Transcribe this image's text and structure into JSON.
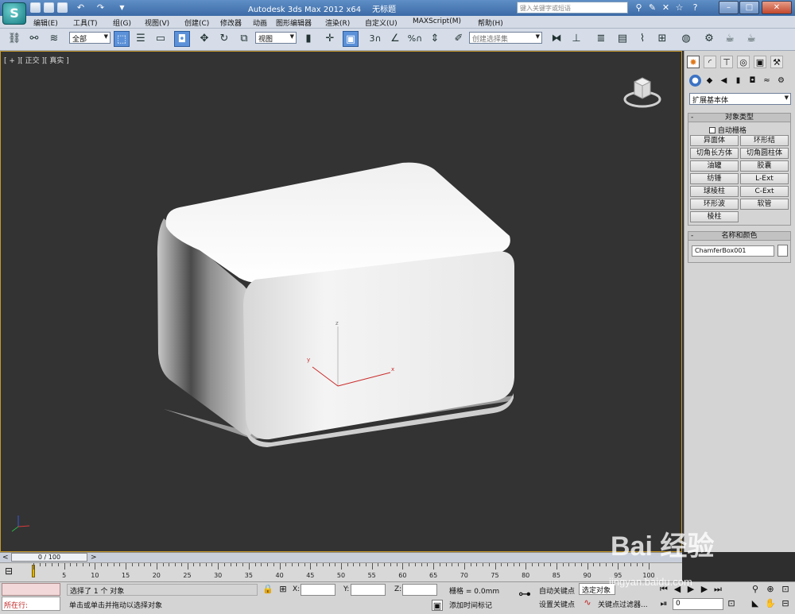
{
  "titlebar": {
    "app_title": "Autodesk 3ds Max  2012 x64",
    "doc_title": "无标题",
    "search_placeholder": "键入关键字或短语"
  },
  "menubar": {
    "items": [
      "编辑(E)",
      "工具(T)",
      "组(G)",
      "视图(V)",
      "创建(C)",
      "修改器",
      "动画",
      "图形编辑器",
      "渲染(R)",
      "自定义(U)",
      "MAXScript(M)",
      "帮助(H)"
    ]
  },
  "toolbar": {
    "selection_filter": "全部",
    "ref_coord": "视图",
    "named_selection": "创建选择集"
  },
  "viewport": {
    "label": "[ + ][ 正交 ][ 真实 ]",
    "axis_x": "x",
    "axis_y": "y",
    "axis_z": "z"
  },
  "command_panel": {
    "category_dropdown": "扩展基本体",
    "object_type": {
      "header": "对象类型",
      "autogrid_label": "自动栅格",
      "buttons": [
        "异面体",
        "环形结",
        "切角长方体",
        "切角圆柱体",
        "油罐",
        "胶囊",
        "纺锤",
        "L-Ext",
        "球棱柱",
        "C-Ext",
        "环形波",
        "软管",
        "棱柱"
      ]
    },
    "name_color": {
      "header": "名称和颜色",
      "name_value": "ChamferBox001",
      "color": "#ffffff"
    }
  },
  "timeline": {
    "frame_display": "0 / 100",
    "ticks": [
      "0",
      "5",
      "10",
      "15",
      "20",
      "25",
      "30",
      "35",
      "40",
      "45",
      "50",
      "55",
      "60",
      "65",
      "70",
      "75",
      "80",
      "85",
      "90",
      "95",
      "100"
    ]
  },
  "status_bar": {
    "listener_label": "所在行:",
    "selection_status": "选择了 1 个 对象",
    "prompt": "单击或单击并拖动以选择对象",
    "x_label": "X:",
    "y_label": "Y:",
    "z_label": "Z:",
    "grid": "栅格 = 0.0mm",
    "add_time_tag": "添加时间标记",
    "auto_key": "自动关键点",
    "set_key": "设置关键点",
    "selected_dropdown": "选定对象",
    "key_filters": "关键点过滤器...",
    "current_frame": "0"
  },
  "watermark": {
    "text": "Bai 经验",
    "url": "jingyan.baidu.com"
  }
}
